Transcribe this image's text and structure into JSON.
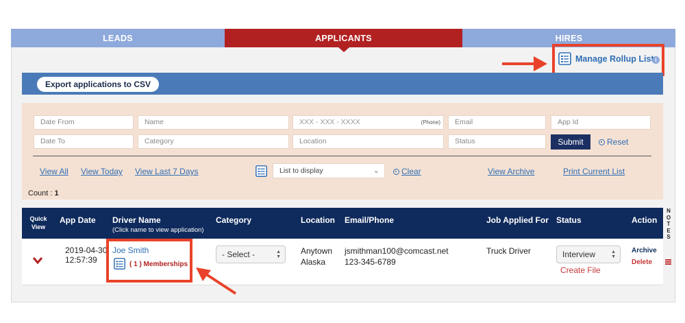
{
  "tabs": [
    {
      "label": "LEADS"
    },
    {
      "label": "APPLICANTS"
    },
    {
      "label": "HIRES"
    }
  ],
  "rollup": {
    "label": "Manage Rollup Lists",
    "icon": "list-scroll-icon",
    "info_icon": "info-icon"
  },
  "toolbar": {
    "export_label": "Export applications to CSV"
  },
  "filters": {
    "date_from": "Date From",
    "name": "Name",
    "phone": "XXX  - XXX  - XXXX",
    "phone_tag": "(Phone)",
    "email": "Email",
    "app_id": "App Id",
    "date_to": "Date To",
    "category": "Category",
    "location": "Location",
    "status": "Status",
    "submit": "Submit",
    "reset": "Reset"
  },
  "views": {
    "view_all": "View All",
    "view_today": "View Today",
    "view_last7": "View Last 7 Days",
    "list_to_display": "List to display",
    "clear": "Clear",
    "view_archive": "View Archive",
    "print_current": "Print Current List"
  },
  "count": {
    "label": "Count : ",
    "value": "1"
  },
  "table": {
    "headers": {
      "quick_view": "Quick View",
      "app_date": "App Date",
      "driver_name": "Driver Name",
      "driver_name_sub": "(Click name to view application)",
      "category": "Category",
      "location": "Location",
      "email_phone": "Email/Phone",
      "job_applied": "Job Applied For",
      "status": "Status",
      "action": "Action",
      "notes": [
        "N",
        "O",
        "T",
        "E",
        "S"
      ]
    },
    "rows": [
      {
        "app_date": "2019-04-30",
        "app_time": "12:57:39",
        "driver_name": "Joe  Smith",
        "memberships": "( 1 ) Memberships",
        "category_select": "- Select -",
        "location_city": "Anytown",
        "location_state": "Alaska",
        "email": "jsmithman100@comcast.net",
        "phone": "123-345-6789",
        "job": "Truck Driver",
        "status_select": "Interview",
        "create_file": "Create File",
        "archive": "Archive",
        "delete": "Delete"
      }
    ]
  },
  "colors": {
    "accent_red": "#b22121",
    "tab_blue": "#8ea9db",
    "header_navy": "#0f2a5c",
    "highlight": "#e8432a",
    "link": "#2f6eb5"
  }
}
